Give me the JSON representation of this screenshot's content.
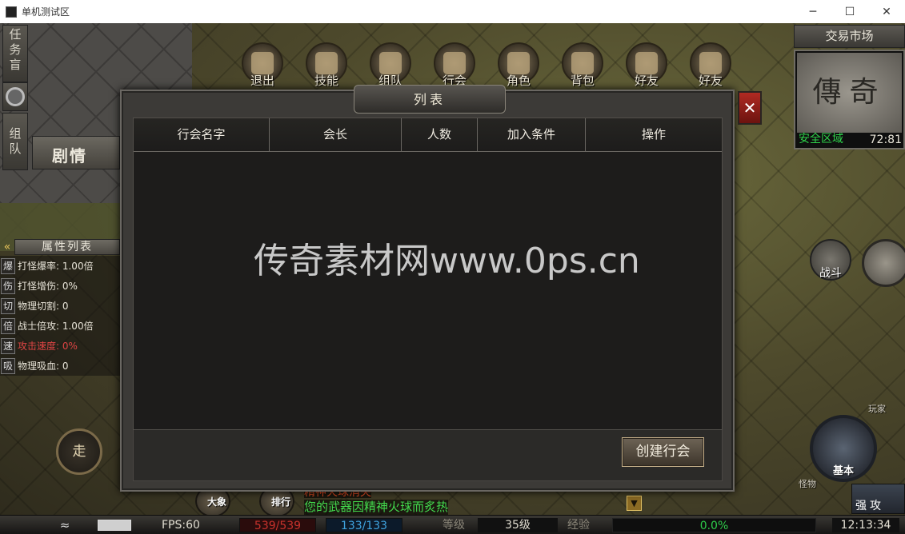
{
  "window": {
    "title": "单机测试区",
    "minimize": "─",
    "maximize": "☐",
    "close": "✕"
  },
  "left_tabs": {
    "task": "任务盲",
    "team": "组队",
    "story": "剧情"
  },
  "top_menu": [
    {
      "label": "退出",
      "icon": "exit-icon"
    },
    {
      "label": "技能",
      "icon": "skill-book-icon"
    },
    {
      "label": "组队",
      "icon": "team-icon"
    },
    {
      "label": "行会",
      "icon": "guild-icon"
    },
    {
      "label": "角色",
      "icon": "character-icon"
    },
    {
      "label": "背包",
      "icon": "bag-icon"
    },
    {
      "label": "好友",
      "icon": "handshake-icon"
    },
    {
      "label": "好友",
      "icon": "friend-icon"
    }
  ],
  "attributes": {
    "header": "属性列表",
    "toggle": "«",
    "rows": [
      {
        "key": "爆",
        "text": "打怪爆率: 1.00倍",
        "red": false
      },
      {
        "key": "伤",
        "text": "打怪增伤: 0%",
        "red": false
      },
      {
        "key": "切",
        "text": "物理切割: 0",
        "red": false
      },
      {
        "key": "倍",
        "text": "战士倍攻: 1.00倍",
        "red": false
      },
      {
        "key": "速",
        "text": "攻击速度: 0%",
        "red": true
      },
      {
        "key": "吸",
        "text": "物理吸血: 0",
        "red": false
      }
    ]
  },
  "walk_button": "走",
  "market": {
    "label": "交易市场",
    "map_text": "傳奇",
    "zone": "安全区域",
    "coords": "72:81"
  },
  "fight_button": "战斗",
  "skills": {
    "basic": "基本",
    "player": "玩家",
    "item": "怪物",
    "strong": "强攻",
    "left1": "大象",
    "left2": "排行"
  },
  "chat": {
    "line1": "精神火球消失",
    "line2": "您的武器因精神火球而炙热",
    "toggle": "▼"
  },
  "status": {
    "wifi": "≈",
    "fps": "FPS:60",
    "hp": "539/539",
    "mp": "133/133",
    "level_label": "等级",
    "level": "35级",
    "exp_label": "经验",
    "exp": "0.0%",
    "time": "12:13:34"
  },
  "modal": {
    "title": "列表",
    "close": "✕",
    "columns": [
      "行会名字",
      "会长",
      "人数",
      "加入条件",
      "操作"
    ],
    "create_button": "创建行会"
  },
  "watermark": "传奇素材网www.0ps.cn",
  "colors": {
    "hp": "#c8322c",
    "mp": "#3fa3df",
    "exp": "#2ecc4a",
    "zone": "#2ed14a",
    "chat_system": "#e24b22",
    "chat_info": "#43d94d",
    "close_button": "#b02a22"
  }
}
